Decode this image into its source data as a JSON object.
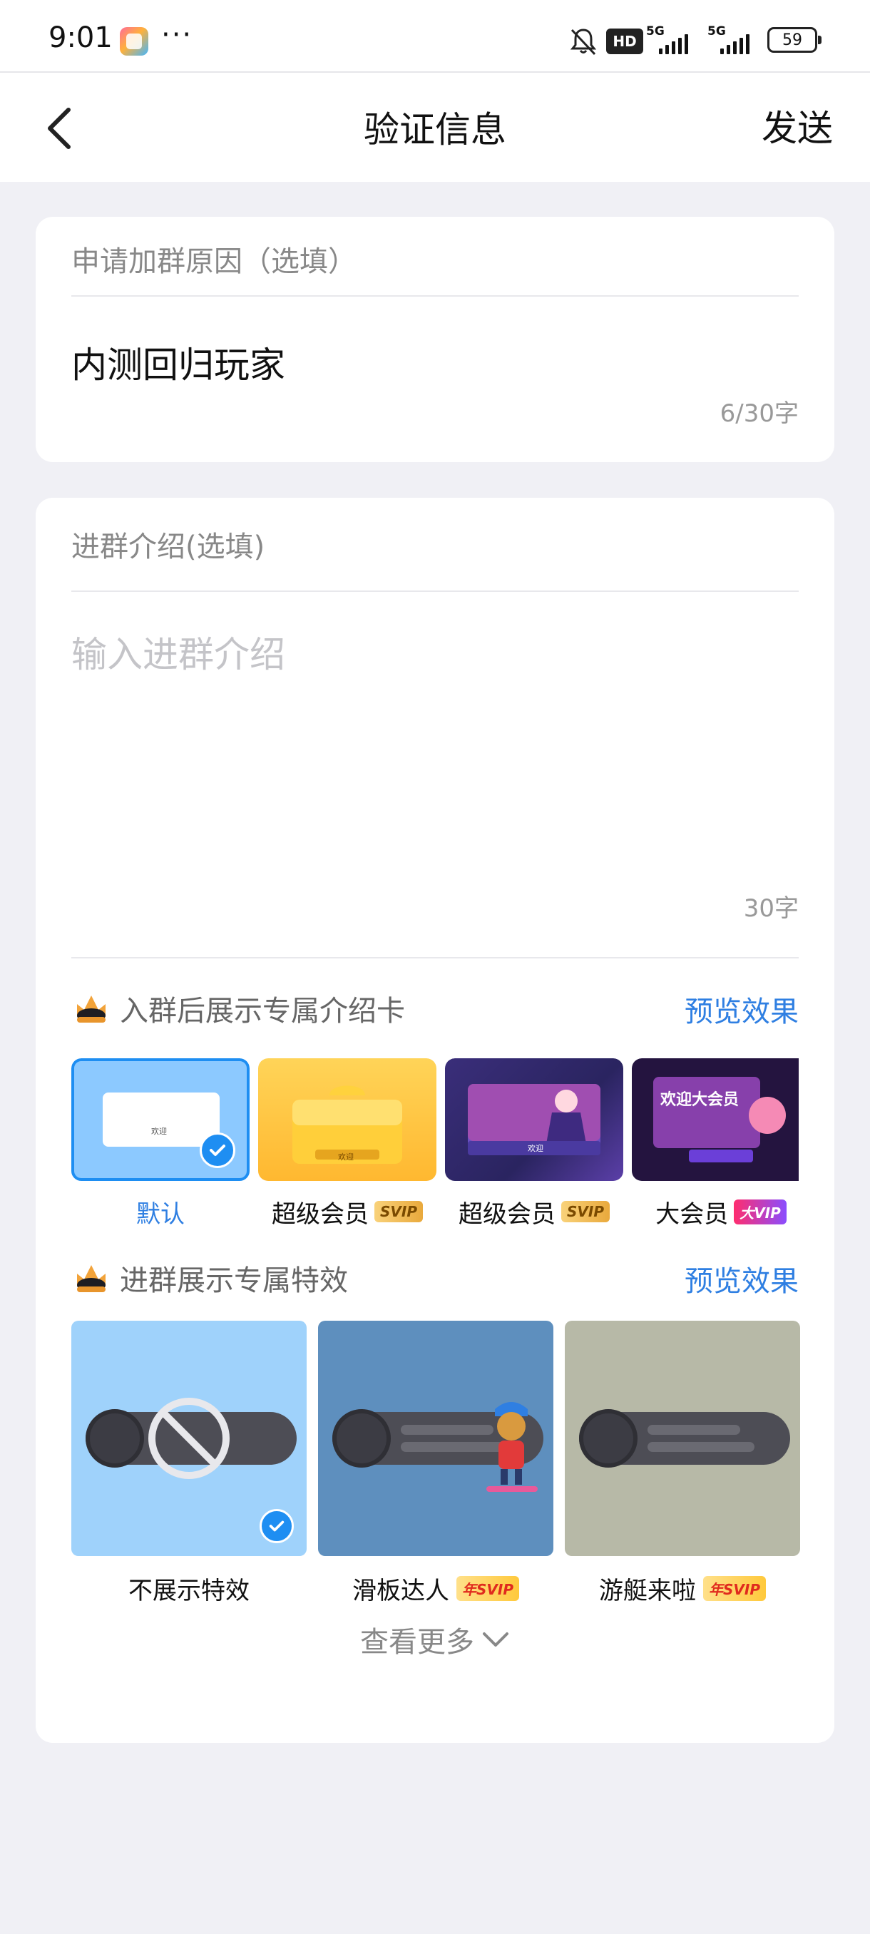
{
  "status_bar": {
    "time": "9:01",
    "more": "···",
    "hd": "HD",
    "signal_1": "5G",
    "signal_2": "5G",
    "battery": "59"
  },
  "nav": {
    "title": "验证信息",
    "send_label": "发送"
  },
  "reason": {
    "label": "申请加群原因（选填）",
    "value": "内测回归玩家",
    "counter": "6/30字"
  },
  "intro": {
    "label": "进群介绍(选填)",
    "placeholder": "输入进群介绍",
    "counter": "30字"
  },
  "intro_card_section": {
    "title": "入群后展示专属介绍卡",
    "preview": "预览效果",
    "cards": [
      {
        "label": "默认",
        "badge": "",
        "selected": true,
        "thumb_text": "欢迎"
      },
      {
        "label": "超级会员",
        "badge": "SVIP",
        "selected": false,
        "thumb_text": "欢迎"
      },
      {
        "label": "超级会员",
        "badge": "SVIP",
        "selected": false,
        "thumb_text": "欢迎"
      },
      {
        "label": "大会员",
        "badge": "大VIP",
        "selected": false,
        "thumb_text": "欢迎大会员"
      }
    ]
  },
  "effect_section": {
    "title": "进群展示专属特效",
    "preview": "预览效果",
    "effects": [
      {
        "label": "不展示特效",
        "badge": "",
        "selected": true
      },
      {
        "label": "滑板达人",
        "badge": "年SVIP",
        "selected": false
      },
      {
        "label": "游艇来啦",
        "badge": "年SVIP",
        "selected": false
      }
    ]
  },
  "see_more": "查看更多",
  "colors": {
    "accent": "#2f7fe2",
    "selected_border": "#1e8ef2",
    "page_bg": "#f0f0f5"
  }
}
